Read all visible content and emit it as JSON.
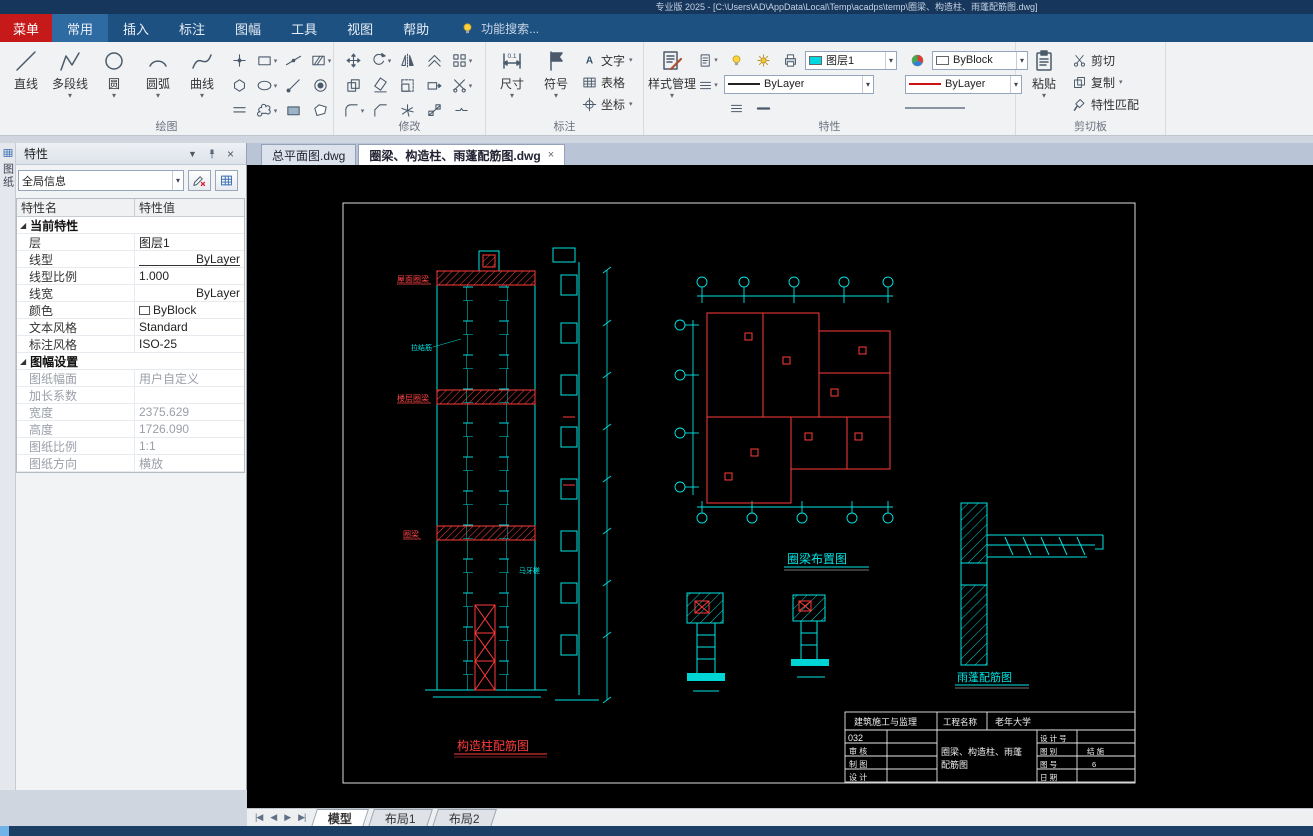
{
  "window": {
    "title_partial": "专业版 2025 - [C:\\Users\\AD\\AppData\\Local\\Temp\\acadps\\temp\\圈梁、构造柱、雨蓬配筋图.dwg]"
  },
  "icons": {
    "panel_menu_glyph": "▼",
    "panel_close_glyph": "×",
    "caret_glyph": "▾",
    "nav_first": "|◀",
    "nav_prev": "◀",
    "nav_next": "▶",
    "nav_last": "▶|"
  },
  "menubar": {
    "menu_button": "菜单",
    "tabs": [
      {
        "label": "常用",
        "active": true
      },
      {
        "label": "插入",
        "active": false
      },
      {
        "label": "标注",
        "active": false
      },
      {
        "label": "图幅",
        "active": false
      },
      {
        "label": "工具",
        "active": false
      },
      {
        "label": "视图",
        "active": false
      },
      {
        "label": "帮助",
        "active": false
      }
    ],
    "search_label": "功能搜索..."
  },
  "ribbon": {
    "groups": {
      "draw": {
        "label": "绘图",
        "big": [
          {
            "name": "line-tool",
            "label": "直线",
            "shape": "line",
            "dropdown": false
          },
          {
            "name": "polyline-tool",
            "label": "多段线",
            "shape": "polyline",
            "dropdown": true
          },
          {
            "name": "circle-tool",
            "label": "圆",
            "shape": "circle",
            "dropdown": true
          },
          {
            "name": "arc-tool",
            "label": "圆弧",
            "shape": "arc",
            "dropdown": true
          },
          {
            "name": "spline-tool",
            "label": "曲线",
            "shape": "spline",
            "dropdown": true
          }
        ],
        "small": [
          {
            "name": "point-tool-icon",
            "shape": "point",
            "caret": false
          },
          {
            "name": "rectangle-tool-icon",
            "shape": "rect",
            "caret": true
          },
          {
            "name": "construction-line-tool-icon",
            "shape": "xline",
            "caret": false
          },
          {
            "name": "hatch-tool-icon",
            "shape": "hatch",
            "caret": true
          },
          {
            "name": "polygon-tool-icon",
            "shape": "polygon",
            "caret": false
          },
          {
            "name": "ellipse-tool-icon",
            "shape": "ellipse",
            "caret": true
          },
          {
            "name": "ray-tool-icon",
            "shape": "ray",
            "caret": false
          },
          {
            "name": "donut-tool-icon",
            "shape": "donut",
            "caret": false
          },
          {
            "name": "multiline-tool-icon",
            "shape": "mline",
            "caret": false
          },
          {
            "name": "revision-cloud-tool-icon",
            "shape": "cloud",
            "caret": true
          },
          {
            "name": "region-tool-icon",
            "shape": "region",
            "caret": false
          },
          {
            "name": "wipeout-tool-icon",
            "shape": "wipeout",
            "caret": false
          }
        ]
      },
      "modify": {
        "label": "修改",
        "small": [
          {
            "name": "move-tool-icon",
            "shape": "move",
            "caret": false
          },
          {
            "name": "rotate-tool-icon",
            "shape": "rotate",
            "caret": true
          },
          {
            "name": "mirror-tool-icon",
            "shape": "mirror",
            "caret": false
          },
          {
            "name": "offset-tool-icon",
            "shape": "offset",
            "caret": false
          },
          {
            "name": "array-tool-icon",
            "shape": "array",
            "caret": true
          },
          {
            "name": "copy-tool-icon",
            "shape": "copy",
            "caret": false
          },
          {
            "name": "erase-tool-icon",
            "shape": "erase",
            "caret": false
          },
          {
            "name": "scale-tool-icon",
            "shape": "scale",
            "caret": false
          },
          {
            "name": "stretch-tool-icon",
            "shape": "stretch",
            "caret": false
          },
          {
            "name": "trim-tool-icon",
            "shape": "trim",
            "caret": true
          },
          {
            "name": "fillet-tool-icon",
            "shape": "fillet",
            "caret": true
          },
          {
            "name": "chamfer-tool-icon",
            "shape": "chamfer",
            "caret": false
          },
          {
            "name": "explode-tool-icon",
            "shape": "explode",
            "caret": false
          },
          {
            "name": "align-tool-icon",
            "shape": "align",
            "caret": false
          },
          {
            "name": "break-tool-icon",
            "shape": "breakk",
            "caret": false
          }
        ]
      },
      "annotate": {
        "label": "标注",
        "big": [
          {
            "label": "尺寸"
          },
          {
            "label": "符号"
          }
        ],
        "list": [
          {
            "label": "文字"
          },
          {
            "label": "表格"
          },
          {
            "label": "坐标"
          }
        ]
      },
      "props": {
        "label": "特性",
        "style_manager": "样式管理",
        "layer_value": "图层1",
        "layer_color": "#00d7e0",
        "byblock_value": "ByBlock",
        "byblock_color": "#ffffff",
        "linetype_value": "ByLayer",
        "linetype_color": "#222222",
        "color_value": "ByLayer",
        "color_color": "#cc1111"
      },
      "clipboard": {
        "label": "剪切板",
        "paste": "粘贴",
        "cut": "剪切",
        "copy": "复制",
        "match": "特性匹配"
      }
    }
  },
  "properties_panel": {
    "title": "特性",
    "side_tab": "图纸",
    "scope_combo": "全局信息",
    "header": {
      "name": "特性名",
      "value": "特性值"
    },
    "rows": [
      {
        "type": "group",
        "name": "当前特性"
      },
      {
        "type": "item",
        "name": "层",
        "value": "图层1"
      },
      {
        "type": "item",
        "name": "线型",
        "value": "ByLayer",
        "align": "right",
        "linetype_sample": true
      },
      {
        "type": "item",
        "name": "线型比例",
        "value": "1.000"
      },
      {
        "type": "item",
        "name": "线宽",
        "value": "ByLayer",
        "align": "right"
      },
      {
        "type": "item",
        "name": "颜色",
        "value": "ByBlock",
        "swatch": "#ffffff"
      },
      {
        "type": "item",
        "name": "文本风格",
        "value": "Standard"
      },
      {
        "type": "item",
        "name": "标注风格",
        "value": "ISO-25"
      },
      {
        "type": "group",
        "name": "图幅设置"
      },
      {
        "type": "item",
        "name": "图纸幅面",
        "value": "用户自定义",
        "disabled": true
      },
      {
        "type": "item",
        "name": "加长系数",
        "value": "",
        "disabled": true
      },
      {
        "type": "item",
        "name": "宽度",
        "value": "2375.629",
        "disabled": true
      },
      {
        "type": "item",
        "name": "高度",
        "value": "1726.090",
        "disabled": true
      },
      {
        "type": "item",
        "name": "图纸比例",
        "value": "1:1",
        "disabled": true
      },
      {
        "type": "item",
        "name": "图纸方向",
        "value": "横放",
        "disabled": true
      }
    ]
  },
  "document_tabs": [
    {
      "label": "总平面图.dwg",
      "active": false
    },
    {
      "label": "圈梁、构造柱、雨蓬配筋图.dwg",
      "active": true
    }
  ],
  "drawing": {
    "labels": {
      "roof_ring_beam": "屋面圈梁",
      "floor_ring_beam": "楼层圈梁",
      "ring_beam": "圈梁",
      "tie_bar": "拉结筋",
      "toothing": "马牙槎",
      "column_detail_title": "构造柱配筋图",
      "plan_title": "圈梁布置图",
      "canopy_title": "雨蓬配筋图"
    },
    "titleblock": {
      "org": "建筑施工与监理",
      "project_label": "工程名称",
      "project_name": "老年大学",
      "code": "032",
      "review": "审 核",
      "draft": "制 图",
      "design": "设 计",
      "sheet_name_1": "圈梁、构造柱、雨蓬",
      "sheet_name_2": "配筋图",
      "design_no_label": "设 计 号",
      "sheet_type_label": "图 别",
      "sheet_type_value": "结 施",
      "sheet_no_label": "图 号",
      "sheet_no_value": "6",
      "date_label": "日 期"
    },
    "colors": {
      "cyan": "#00e5e5",
      "red": "#ff3b3b",
      "white": "#e8e8e8",
      "bg": "#000000"
    }
  },
  "layout_tabs": [
    {
      "label": "模型",
      "active": true
    },
    {
      "label": "布局1",
      "active": false
    },
    {
      "label": "布局2",
      "active": false
    }
  ]
}
